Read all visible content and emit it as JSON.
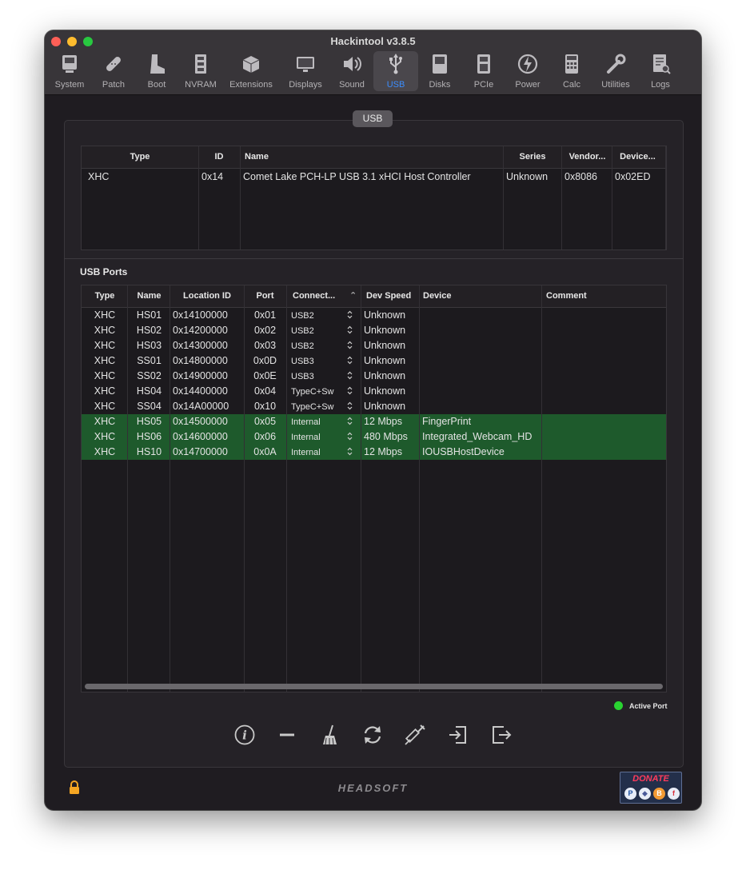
{
  "window": {
    "title": "Hackintool v3.8.5"
  },
  "toolbar": [
    {
      "label": "System",
      "icon": "system-icon"
    },
    {
      "label": "Patch",
      "icon": "patch-icon"
    },
    {
      "label": "Boot",
      "icon": "boot-icon"
    },
    {
      "label": "NVRAM",
      "icon": "nvram-icon"
    },
    {
      "label": "Extensions",
      "icon": "extensions-icon"
    },
    {
      "label": "Displays",
      "icon": "displays-icon"
    },
    {
      "label": "Sound",
      "icon": "sound-icon"
    },
    {
      "label": "USB",
      "icon": "usb-icon",
      "active": true
    },
    {
      "label": "Disks",
      "icon": "disks-icon"
    },
    {
      "label": "PCIe",
      "icon": "pcie-icon"
    },
    {
      "label": "Power",
      "icon": "power-icon"
    },
    {
      "label": "Calc",
      "icon": "calc-icon"
    },
    {
      "label": "Utilities",
      "icon": "utilities-icon"
    },
    {
      "label": "Logs",
      "icon": "logs-icon"
    }
  ],
  "panel": {
    "tab": "USB"
  },
  "controllers": {
    "headers": [
      "Type",
      "ID",
      "Name",
      "Series",
      "Vendor...",
      "Device..."
    ],
    "rows": [
      {
        "type": "XHC",
        "id": "0x14",
        "name": "Comet Lake PCH-LP USB 3.1 xHCI Host Controller",
        "series": "Unknown",
        "vendor": "0x8086",
        "device": "0x02ED"
      }
    ]
  },
  "ports": {
    "section_label": "USB Ports",
    "headers": [
      "Type",
      "Name",
      "Location ID",
      "Port",
      "Connect...",
      "Dev Speed",
      "Device",
      "Comment"
    ],
    "rows": [
      {
        "type": "XHC",
        "name": "HS01",
        "location": "0x14100000",
        "port": "0x01",
        "connector": "USB2",
        "speed": "Unknown",
        "device": "",
        "comment": "",
        "active": false
      },
      {
        "type": "XHC",
        "name": "HS02",
        "location": "0x14200000",
        "port": "0x02",
        "connector": "USB2",
        "speed": "Unknown",
        "device": "",
        "comment": "",
        "active": false
      },
      {
        "type": "XHC",
        "name": "HS03",
        "location": "0x14300000",
        "port": "0x03",
        "connector": "USB2",
        "speed": "Unknown",
        "device": "",
        "comment": "",
        "active": false
      },
      {
        "type": "XHC",
        "name": "SS01",
        "location": "0x14800000",
        "port": "0x0D",
        "connector": "USB3",
        "speed": "Unknown",
        "device": "",
        "comment": "",
        "active": false
      },
      {
        "type": "XHC",
        "name": "SS02",
        "location": "0x14900000",
        "port": "0x0E",
        "connector": "USB3",
        "speed": "Unknown",
        "device": "",
        "comment": "",
        "active": false
      },
      {
        "type": "XHC",
        "name": "HS04",
        "location": "0x14400000",
        "port": "0x04",
        "connector": "TypeC+Sw",
        "speed": "Unknown",
        "device": "",
        "comment": "",
        "active": false
      },
      {
        "type": "XHC",
        "name": "SS04",
        "location": "0x14A00000",
        "port": "0x10",
        "connector": "TypeC+Sw",
        "speed": "Unknown",
        "device": "",
        "comment": "",
        "active": false
      },
      {
        "type": "XHC",
        "name": "HS05",
        "location": "0x14500000",
        "port": "0x05",
        "connector": "Internal",
        "speed": "12 Mbps",
        "device": "FingerPrint",
        "comment": "",
        "active": true
      },
      {
        "type": "XHC",
        "name": "HS06",
        "location": "0x14600000",
        "port": "0x06",
        "connector": "Internal",
        "speed": "480 Mbps",
        "device": "Integrated_Webcam_HD",
        "comment": "",
        "active": true
      },
      {
        "type": "XHC",
        "name": "HS10",
        "location": "0x14700000",
        "port": "0x0A",
        "connector": "Internal",
        "speed": "12 Mbps",
        "device": "IOUSBHostDevice",
        "comment": "",
        "active": true
      }
    ]
  },
  "legend": {
    "label": "Active Port",
    "color": "#29d331"
  },
  "actions": [
    "info-icon",
    "remove-icon",
    "clean-icon",
    "refresh-icon",
    "inject-icon",
    "import-icon",
    "export-icon"
  ],
  "footer": {
    "brand": "HEADSOFT",
    "donate": "DONATE"
  },
  "colors": {
    "accent": "#3b8dfe",
    "active_row": "#1e5a2c"
  }
}
